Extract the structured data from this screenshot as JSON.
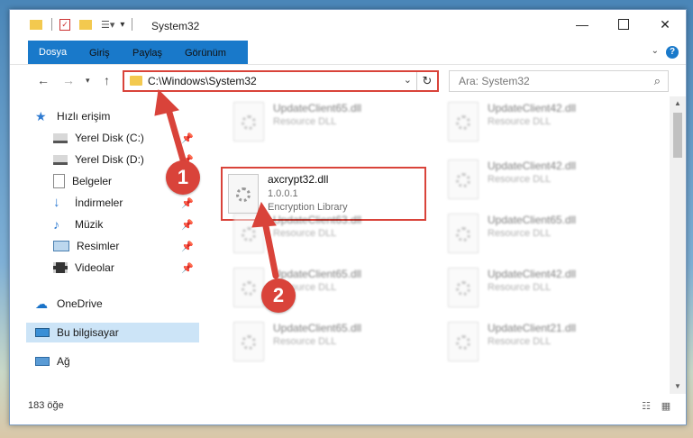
{
  "window": {
    "title": "System32"
  },
  "ribbon": {
    "tabs": [
      "Dosya",
      "Giriş",
      "Paylaş",
      "Görünüm"
    ],
    "help": "?"
  },
  "address": {
    "path": "C:\\Windows\\System32"
  },
  "search": {
    "placeholder": "Ara: System32"
  },
  "nav": {
    "items": [
      {
        "label": "Hızlı erişim",
        "icon": "star-icon"
      },
      {
        "label": "Yerel Disk (C:)",
        "icon": "drive-icon",
        "pinned": true
      },
      {
        "label": "Yerel Disk (D:)",
        "icon": "drive-icon",
        "pinned": true
      },
      {
        "label": "Belgeler",
        "icon": "document-icon",
        "pinned": true
      },
      {
        "label": "İndirmeler",
        "icon": "download-icon",
        "pinned": true
      },
      {
        "label": "Müzik",
        "icon": "music-icon",
        "pinned": true
      },
      {
        "label": "Resimler",
        "icon": "pictures-icon",
        "pinned": true
      },
      {
        "label": "Videolar",
        "icon": "video-icon",
        "pinned": true
      },
      {
        "label": "OneDrive",
        "icon": "cloud-icon"
      },
      {
        "label": "Bu bilgisayar",
        "icon": "computer-icon",
        "selected": true
      },
      {
        "label": "Ağ",
        "icon": "network-icon"
      }
    ]
  },
  "files": {
    "left": [
      {
        "name": "UpdateClient65.dll",
        "type": "Resource DLL"
      },
      {
        "name": "axcrypt32.dll",
        "version": "1.0.0.1",
        "type": "Encryption Library"
      },
      {
        "name": "UpdateClient63.dll",
        "type": "Resource DLL"
      },
      {
        "name": "UpdateClient65.dll",
        "type": "Resource DLL"
      },
      {
        "name": "UpdateClient65.dll",
        "type": "Resource DLL"
      }
    ],
    "right": [
      {
        "name": "UpdateClient42.dll",
        "type": "Resource DLL"
      },
      {
        "name": "UpdateClient42.dll",
        "type": "Resource DLL"
      },
      {
        "name": "UpdateClient65.dll",
        "type": "Resource DLL"
      },
      {
        "name": "UpdateClient42.dll",
        "type": "Resource DLL"
      },
      {
        "name": "UpdateClient21.dll",
        "type": "Resource DLL"
      }
    ]
  },
  "status": {
    "count": "183 öğe"
  },
  "annotations": {
    "step1": "1",
    "step2": "2"
  },
  "colors": {
    "accent": "#1979ca",
    "highlight": "#d9433a",
    "selected_bg": "#cce4f7"
  }
}
